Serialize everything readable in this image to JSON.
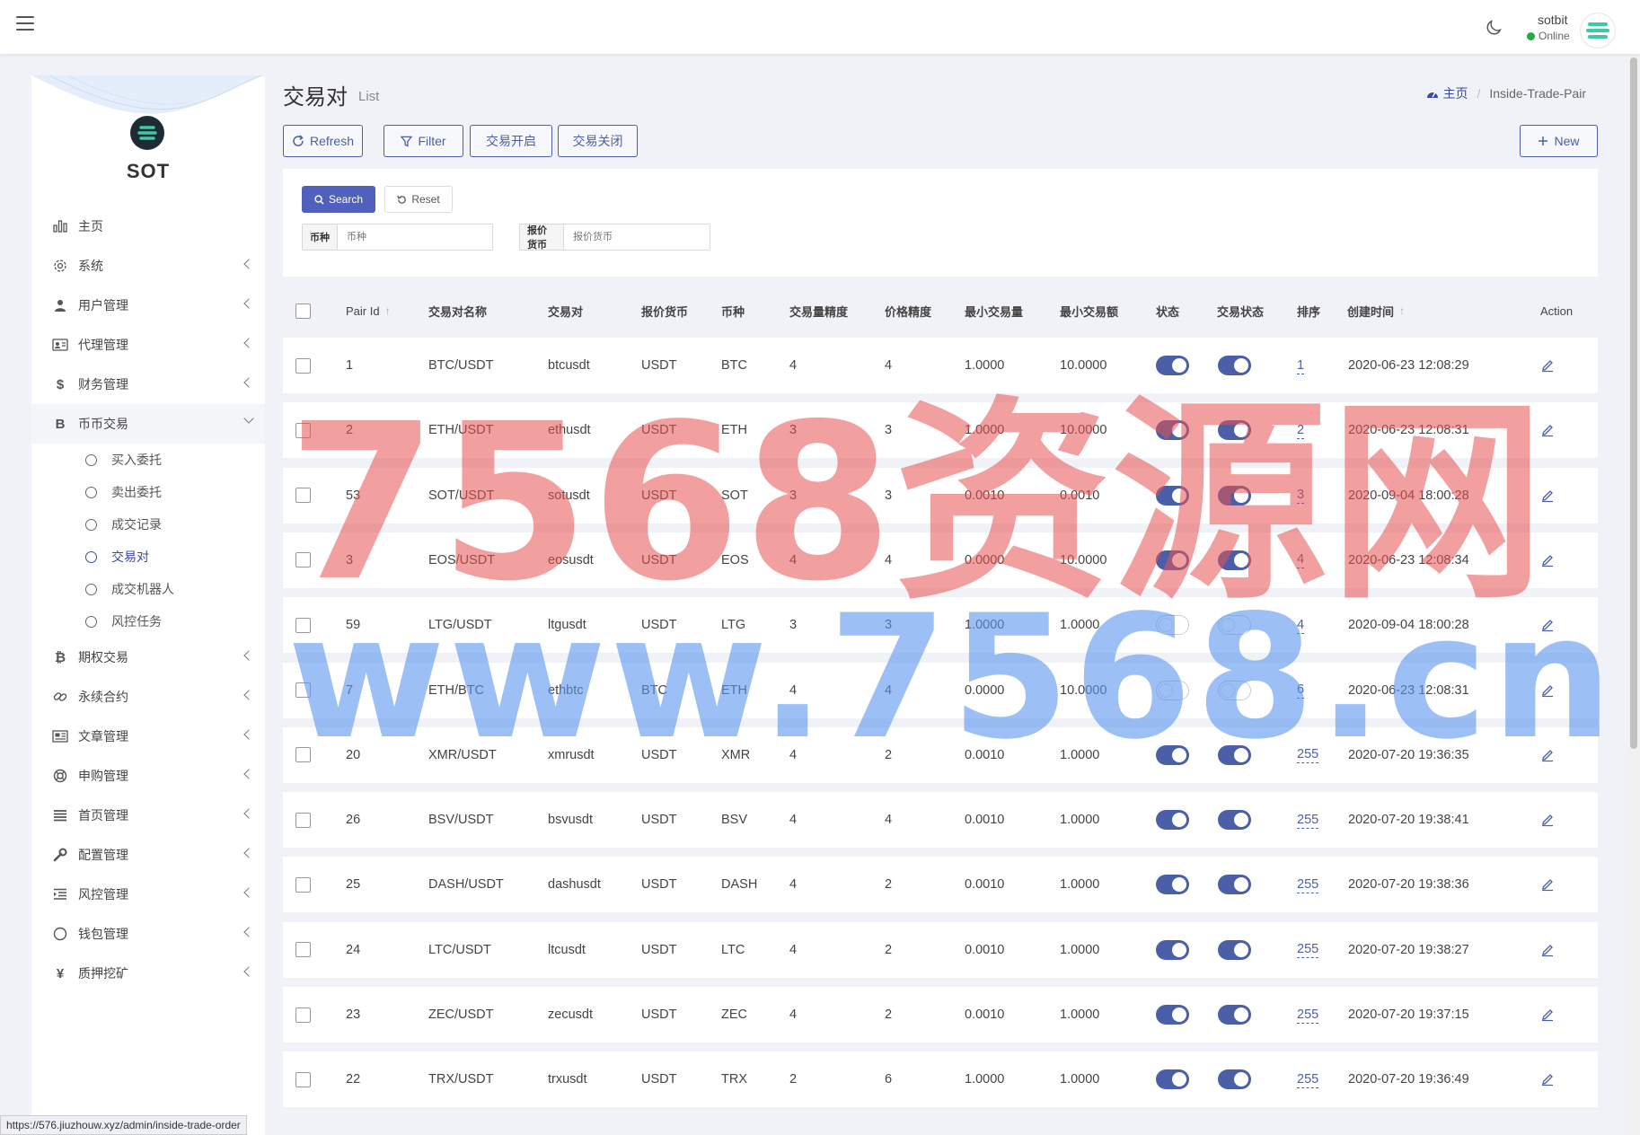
{
  "navbar": {
    "user_name": "sotbit",
    "user_status": "Online"
  },
  "brand": {
    "name": "SOT"
  },
  "sidebar": {
    "items": [
      {
        "label": "主页",
        "icon": "bar-chart-icon",
        "has_chevron": false
      },
      {
        "label": "系统",
        "icon": "gear-icon",
        "has_chevron": true
      },
      {
        "label": "用户管理",
        "icon": "user-icon",
        "has_chevron": true
      },
      {
        "label": "代理管理",
        "icon": "id-card-icon",
        "has_chevron": true
      },
      {
        "label": "财务管理",
        "icon": "dollar-icon",
        "has_chevron": true
      },
      {
        "label": "币币交易",
        "icon": "bitcoin-icon",
        "has_chevron": true,
        "open": true
      }
    ],
    "subitems": [
      {
        "label": "买入委托"
      },
      {
        "label": "卖出委托"
      },
      {
        "label": "成交记录"
      },
      {
        "label": "交易对",
        "current": true
      },
      {
        "label": "成交机器人"
      },
      {
        "label": "风控任务"
      }
    ],
    "items_after": [
      {
        "label": "期权交易",
        "icon": "bitcoin-icon"
      },
      {
        "label": "永续合约",
        "icon": "link-icon"
      },
      {
        "label": "文章管理",
        "icon": "newspaper-icon"
      },
      {
        "label": "申购管理",
        "icon": "lifebuoy-icon"
      },
      {
        "label": "首页管理",
        "icon": "list-icon"
      },
      {
        "label": "配置管理",
        "icon": "wrench-icon"
      },
      {
        "label": "风控管理",
        "icon": "indent-icon"
      },
      {
        "label": "钱包管理",
        "icon": "circle-icon"
      },
      {
        "label": "质押挖矿",
        "icon": "yen-icon"
      }
    ]
  },
  "header": {
    "title": "交易对",
    "subtitle": "List",
    "breadcrumb_home": "主页",
    "breadcrumb_current": "Inside-Trade-Pair"
  },
  "toolbar": {
    "refresh": "Refresh",
    "filter": "Filter",
    "open_trade": "交易开启",
    "close_trade": "交易关闭",
    "new": "New"
  },
  "filter": {
    "search": "Search",
    "reset": "Reset",
    "coin_label": "币种",
    "coin_placeholder": "币种",
    "quote_label": "报价货币",
    "quote_placeholder": "报价货币"
  },
  "table": {
    "headers": [
      "Pair Id",
      "交易对名称",
      "交易对",
      "报价货币",
      "币种",
      "交易量精度",
      "价格精度",
      "最小交易量",
      "最小交易额",
      "状态",
      "交易状态",
      "排序",
      "创建时间",
      "Action"
    ],
    "rows": [
      {
        "id": "1",
        "name": "BTC/USDT",
        "pair": "btcusdt",
        "quote": "USDT",
        "coin": "BTC",
        "vol_prec": "4",
        "price_prec": "4",
        "min_vol": "1.0000",
        "min_amt": "10.0000",
        "status": true,
        "trade_status": true,
        "sort": "1",
        "created": "2020-06-23 12:08:29"
      },
      {
        "id": "2",
        "name": "ETH/USDT",
        "pair": "ethusdt",
        "quote": "USDT",
        "coin": "ETH",
        "vol_prec": "3",
        "price_prec": "3",
        "min_vol": "1.0000",
        "min_amt": "10.0000",
        "status": true,
        "trade_status": true,
        "sort": "2",
        "created": "2020-06-23 12:08:31"
      },
      {
        "id": "53",
        "name": "SOT/USDT",
        "pair": "sotusdt",
        "quote": "USDT",
        "coin": "SOT",
        "vol_prec": "3",
        "price_prec": "3",
        "min_vol": "0.0010",
        "min_amt": "0.0010",
        "status": true,
        "trade_status": true,
        "sort": "3",
        "created": "2020-09-04 18:00:28"
      },
      {
        "id": "3",
        "name": "EOS/USDT",
        "pair": "eosusdt",
        "quote": "USDT",
        "coin": "EOS",
        "vol_prec": "4",
        "price_prec": "4",
        "min_vol": "0.0000",
        "min_amt": "10.0000",
        "status": true,
        "trade_status": true,
        "sort": "4",
        "created": "2020-06-23 12:08:34"
      },
      {
        "id": "59",
        "name": "LTG/USDT",
        "pair": "ltgusdt",
        "quote": "USDT",
        "coin": "LTG",
        "vol_prec": "3",
        "price_prec": "3",
        "min_vol": "1.0000",
        "min_amt": "1.0000",
        "status": false,
        "trade_status": false,
        "sort": "4",
        "created": "2020-09-04 18:00:28"
      },
      {
        "id": "7",
        "name": "ETH/BTC",
        "pair": "ethbtc",
        "quote": "BTC",
        "coin": "ETH",
        "vol_prec": "4",
        "price_prec": "4",
        "min_vol": "0.0000",
        "min_amt": "10.0000",
        "status": false,
        "trade_status": false,
        "sort": "6",
        "created": "2020-06-23 12:08:31"
      },
      {
        "id": "20",
        "name": "XMR/USDT",
        "pair": "xmrusdt",
        "quote": "USDT",
        "coin": "XMR",
        "vol_prec": "4",
        "price_prec": "2",
        "min_vol": "0.0010",
        "min_amt": "1.0000",
        "status": true,
        "trade_status": true,
        "sort": "255",
        "created": "2020-07-20 19:36:35"
      },
      {
        "id": "26",
        "name": "BSV/USDT",
        "pair": "bsvusdt",
        "quote": "USDT",
        "coin": "BSV",
        "vol_prec": "4",
        "price_prec": "4",
        "min_vol": "0.0010",
        "min_amt": "1.0000",
        "status": true,
        "trade_status": true,
        "sort": "255",
        "created": "2020-07-20 19:38:41"
      },
      {
        "id": "25",
        "name": "DASH/USDT",
        "pair": "dashusdt",
        "quote": "USDT",
        "coin": "DASH",
        "vol_prec": "4",
        "price_prec": "2",
        "min_vol": "0.0010",
        "min_amt": "1.0000",
        "status": true,
        "trade_status": true,
        "sort": "255",
        "created": "2020-07-20 19:38:36"
      },
      {
        "id": "24",
        "name": "LTC/USDT",
        "pair": "ltcusdt",
        "quote": "USDT",
        "coin": "LTC",
        "vol_prec": "4",
        "price_prec": "2",
        "min_vol": "0.0010",
        "min_amt": "1.0000",
        "status": true,
        "trade_status": true,
        "sort": "255",
        "created": "2020-07-20 19:38:27"
      },
      {
        "id": "23",
        "name": "ZEC/USDT",
        "pair": "zecusdt",
        "quote": "USDT",
        "coin": "ZEC",
        "vol_prec": "4",
        "price_prec": "2",
        "min_vol": "0.0010",
        "min_amt": "1.0000",
        "status": true,
        "trade_status": true,
        "sort": "255",
        "created": "2020-07-20 19:37:15"
      },
      {
        "id": "22",
        "name": "TRX/USDT",
        "pair": "trxusdt",
        "quote": "USDT",
        "coin": "TRX",
        "vol_prec": "2",
        "price_prec": "6",
        "min_vol": "1.0000",
        "min_amt": "1.0000",
        "status": true,
        "trade_status": true,
        "sort": "255",
        "created": "2020-07-20 19:36:49"
      }
    ]
  },
  "watermark": {
    "line1": "7568资源网",
    "line2": "www.7568.cn"
  },
  "status_url": "https://576.jiuzhouw.xyz/admin/inside-trade-order",
  "colors": {
    "accent": "#4a5fa8",
    "search_button": "#5260bd",
    "online": "#28a745",
    "background": "#f0f2f7"
  }
}
